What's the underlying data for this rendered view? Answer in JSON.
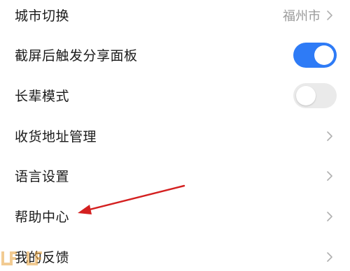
{
  "settings": {
    "items": [
      {
        "label": "城市切换",
        "value": "福州市",
        "type": "link"
      },
      {
        "label": "截屏后触发分享面板",
        "type": "toggle",
        "checked": true
      },
      {
        "label": "长辈模式",
        "type": "toggle",
        "checked": false
      },
      {
        "label": "收货地址管理",
        "type": "link"
      },
      {
        "label": "语言设置",
        "type": "link"
      },
      {
        "label": "帮助中心",
        "type": "link"
      },
      {
        "label": "我的反馈",
        "type": "link"
      }
    ]
  },
  "colors": {
    "toggle_on": "#2e7bf6",
    "toggle_off": "#eaeaea",
    "annotation_arrow": "#d42020",
    "chevron": "#b0b0b0"
  },
  "icons": {
    "chevron": "chevron-right-icon",
    "annotation": "red-arrow-annotation"
  }
}
